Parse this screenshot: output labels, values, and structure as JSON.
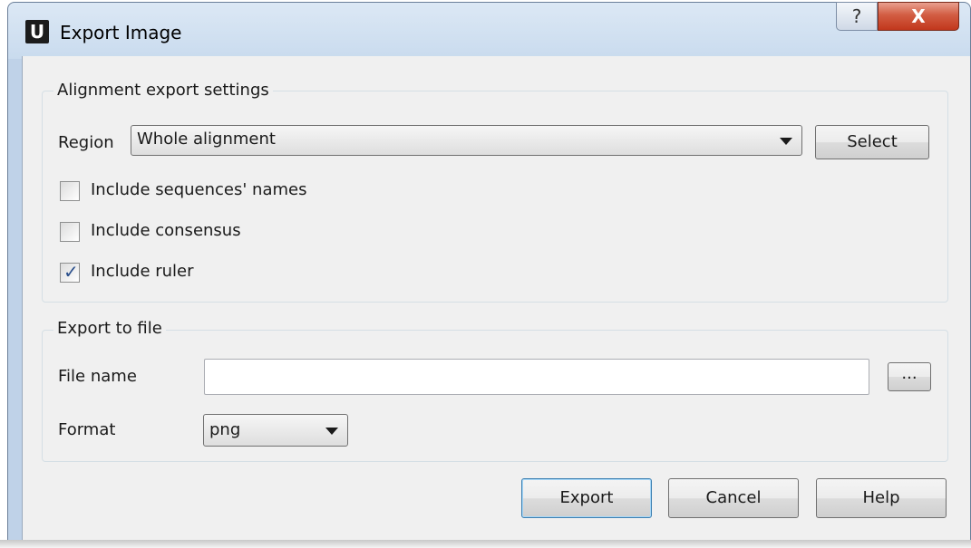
{
  "window": {
    "icon_letter": "U",
    "title": "Export Image",
    "help_glyph": "?",
    "close_glyph": "X"
  },
  "alignment_settings": {
    "legend": "Alignment export settings",
    "region_label": "Region",
    "region_value": "Whole alignment",
    "select_button": "Select",
    "checkboxes": [
      {
        "label": "Include sequences' names",
        "checked": false
      },
      {
        "label": "Include consensus",
        "checked": false
      },
      {
        "label": "Include ruler",
        "checked": true
      }
    ]
  },
  "export_file": {
    "legend": "Export to file",
    "file_name_label": "File name",
    "file_name_value": "",
    "browse_button": "...",
    "format_label": "Format",
    "format_value": "png"
  },
  "buttons": {
    "export": "Export",
    "cancel": "Cancel",
    "help": "Help"
  }
}
